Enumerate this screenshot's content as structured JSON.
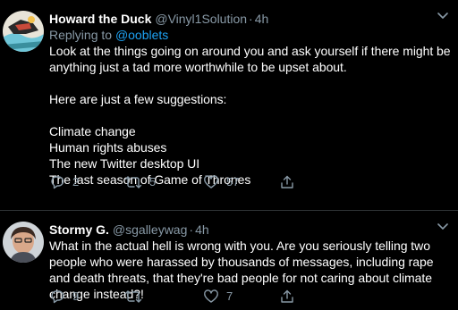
{
  "tweets": [
    {
      "name": "Howard the Duck",
      "handle": "@Vinyl1Solution",
      "separator": "·",
      "time": "4h",
      "reply_prefix": "Replying to",
      "reply_to": "@ooblets",
      "body": {
        "para1": "Look at the things going on around you and ask yourself if there might be anything just a tad more worthwhile to be upset about.",
        "para2": "Here are just a few suggestions:",
        "list": [
          "Climate change",
          "Human rights abuses",
          "The new Twitter desktop UI",
          "The last season of Game of Thrones"
        ]
      },
      "actions": {
        "reply_count": "2",
        "retweet_count": "5",
        "like_count": "57"
      }
    },
    {
      "name": "Stormy G.",
      "handle": "@sgalleywag",
      "separator": "·",
      "time": "4h",
      "body": "What in the actual hell is wrong with you. Are you seriously telling two people who were harassed by thousands of messages, including rape and death threats, that they're bad people for not caring about climate change instead?!",
      "actions": {
        "reply_count": "9",
        "retweet_count": "",
        "like_count": "7"
      }
    }
  ],
  "colors": {
    "background": "#000000",
    "text": "#ffffff",
    "secondary": "#8899a6",
    "link": "#1da1f2",
    "divider": "#2f3336"
  }
}
